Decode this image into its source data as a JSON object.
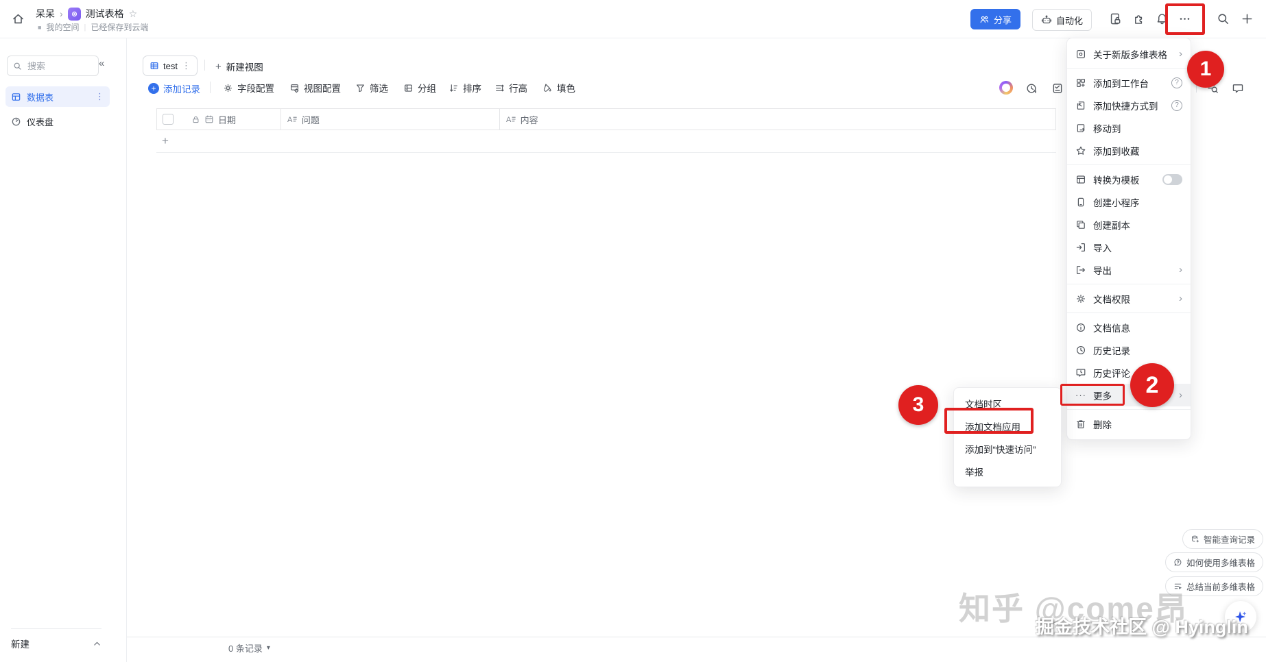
{
  "topbar": {
    "breadcrumb_parent": "呆呆",
    "doc_title": "测试表格",
    "space_label": "我的空间",
    "save_status": "已经保存到云端",
    "share_label": "分享",
    "automation_label": "自动化"
  },
  "sidebar": {
    "search_placeholder": "搜索",
    "items": [
      {
        "label": "数据表"
      },
      {
        "label": "仪表盘"
      }
    ],
    "footer_new_label": "新建"
  },
  "view_tabs": {
    "active_tab": "test",
    "new_view_label": "新建视图"
  },
  "toolbar": {
    "add_record": "添加记录",
    "field_config": "字段配置",
    "view_config": "视图配置",
    "filter": "筛选",
    "group": "分组",
    "sort": "排序",
    "row_height": "行高",
    "fill_color": "填色"
  },
  "table": {
    "columns": [
      {
        "label": "日期"
      },
      {
        "label": "问题"
      },
      {
        "label": "内容"
      }
    ]
  },
  "status_bar": {
    "record_count": "0 条记录"
  },
  "menu": {
    "items": [
      {
        "label": "关于新版多维表格"
      },
      {
        "label": "添加到工作台"
      },
      {
        "label": "添加快捷方式到"
      },
      {
        "label": "移动到"
      },
      {
        "label": "添加到收藏"
      },
      {
        "label": "转换为模板"
      },
      {
        "label": "创建小程序"
      },
      {
        "label": "创建副本"
      },
      {
        "label": "导入"
      },
      {
        "label": "导出"
      },
      {
        "label": "文档权限"
      },
      {
        "label": "文档信息"
      },
      {
        "label": "历史记录"
      },
      {
        "label": "历史评论"
      },
      {
        "label": "更多"
      },
      {
        "label": "删除"
      }
    ]
  },
  "submenu": {
    "items": [
      {
        "label": "文档时区"
      },
      {
        "label": "添加文档应用"
      },
      {
        "label": "添加到“快速访问”"
      },
      {
        "label": "举报"
      }
    ]
  },
  "badges": {
    "one": "1",
    "two": "2",
    "three": "3"
  },
  "assist_buttons": [
    {
      "label": "智能查询记录"
    },
    {
      "label": "如何使用多维表格"
    },
    {
      "label": "总结当前多维表格"
    }
  ],
  "watermarks": {
    "zhihu": "知乎 @come昂",
    "juejin": "掘金技术社区 @ Hyinglin"
  },
  "glyphs": {
    "breadcrumb_sep": "›",
    "star": "☆",
    "collapse": "«",
    "ellipsis_v": "⋮",
    "chevron_right": "›",
    "help": "?",
    "more_dots": "···",
    "plus": "+",
    "dropdown_arrow": "▾",
    "space_square": "■",
    "pipe": "|"
  },
  "colors": {
    "accent_blue": "#3370eb",
    "annotation_red": "#e02020",
    "text_primary": "#1f2329",
    "text_secondary": "#646a73"
  }
}
